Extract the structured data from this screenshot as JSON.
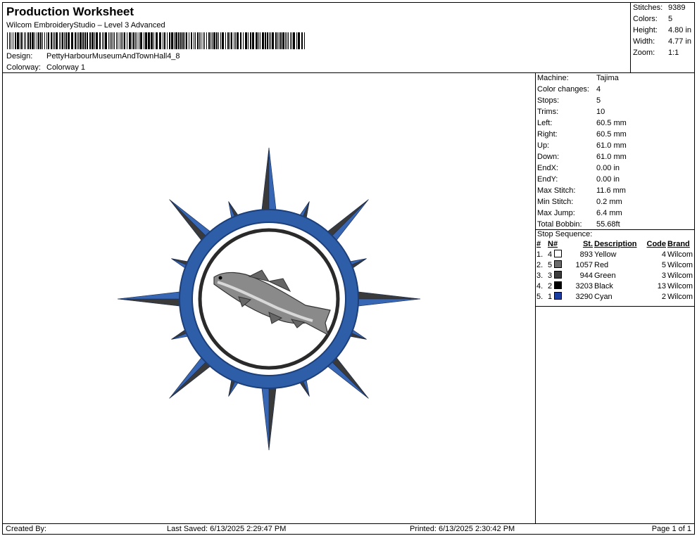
{
  "header": {
    "title": "Production Worksheet",
    "subtitle": "Wilcom EmbroideryStudio – Level 3 Advanced",
    "design_label": "Design:",
    "design_value": "PettyHarbourMuseumAndTownHall4_8",
    "colorway_label": "Colorway:",
    "colorway_value": "Colorway 1"
  },
  "stats": [
    {
      "label": "Stitches:",
      "value": "9389"
    },
    {
      "label": "Colors:",
      "value": "5"
    },
    {
      "label": "Height:",
      "value": "4.80 in"
    },
    {
      "label": "Width:",
      "value": "4.77 in"
    },
    {
      "label": "Zoom:",
      "value": "1:1"
    }
  ],
  "machine_info": [
    {
      "label": "Machine:",
      "value": "Tajima"
    },
    {
      "label": "Color changes:",
      "value": "4"
    },
    {
      "label": "Stops:",
      "value": "5"
    },
    {
      "label": "Trims:",
      "value": "10"
    },
    {
      "label": "Left:",
      "value": "60.5 mm"
    },
    {
      "label": "Right:",
      "value": "60.5 mm"
    },
    {
      "label": "Up:",
      "value": "61.0 mm"
    },
    {
      "label": "Down:",
      "value": "61.0 mm"
    },
    {
      "label": "EndX:",
      "value": "0.00 in"
    },
    {
      "label": "EndY:",
      "value": "0.00 in"
    },
    {
      "label": "Max Stitch:",
      "value": "11.6 mm"
    },
    {
      "label": "Min Stitch:",
      "value": "0.2 mm"
    },
    {
      "label": "Max Jump:",
      "value": "6.4 mm"
    },
    {
      "label": "Total Bobbin:",
      "value": "55.68ft"
    }
  ],
  "stop_sequence": {
    "title": "Stop Sequence:",
    "headers": {
      "num": "#",
      "n": "N#",
      "st": "St.",
      "description": "Description",
      "code": "Code",
      "brand": "Brand"
    },
    "rows": [
      {
        "num": "1.",
        "n": "4",
        "st": "893",
        "description": "Yellow",
        "code": "4",
        "brand": "Wilcom",
        "color": "#ffffff"
      },
      {
        "num": "2.",
        "n": "5",
        "st": "1057",
        "description": "Red",
        "code": "5",
        "brand": "Wilcom",
        "color": "#6b6b6b"
      },
      {
        "num": "3.",
        "n": "3",
        "st": "944",
        "description": "Green",
        "code": "3",
        "brand": "Wilcom",
        "color": "#3c3c3c"
      },
      {
        "num": "4.",
        "n": "2",
        "st": "3203",
        "description": "Black",
        "code": "13",
        "brand": "Wilcom",
        "color": "#000000"
      },
      {
        "num": "5.",
        "n": "1",
        "st": "3290",
        "description": "Cyan",
        "code": "2",
        "brand": "Wilcom",
        "color": "#1a3fa0"
      }
    ]
  },
  "footer": {
    "created_by": "Created By:",
    "last_saved": "Last Saved: 6/13/2025 2:29:47 PM",
    "printed": "Printed: 6/13/2025 2:30:42 PM",
    "page": "Page 1 of 1"
  },
  "design_colors": {
    "ring": "#2f5ea8",
    "ring_dark": "#1c3f7a",
    "star_dark": "#3a3a3a",
    "star_blue": "#3766b4",
    "fish": "#7a7a7a"
  }
}
